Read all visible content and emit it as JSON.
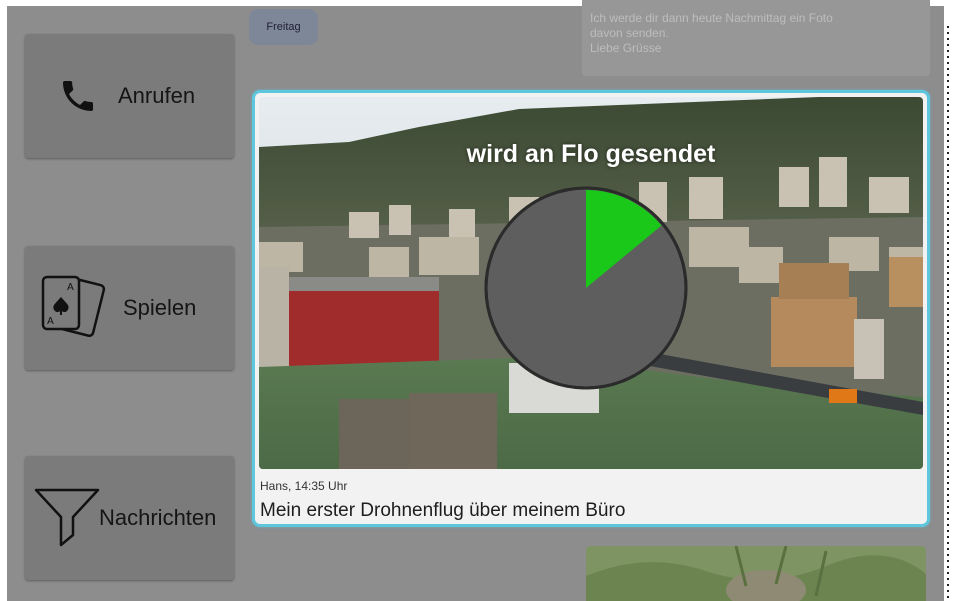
{
  "sidebar": {
    "call_label": "Anrufen",
    "play_label": "Spielen",
    "messages_label": "Nachrichten"
  },
  "chat": {
    "day_label": "Freitag",
    "previous_message_lines": [
      "",
      "Ich werde dir dann heute Nachmittag ein Foto",
      "davon senden.",
      "Liebe Grüsse"
    ],
    "selected_message": {
      "sending_status": "wird an Flo gesendet",
      "send_progress": 0.14,
      "author_time": "Hans, 14:35 Uhr",
      "caption": "Mein erster Drohnenflug über meinem Büro"
    }
  },
  "colors": {
    "selection_border": "#5ec6dd",
    "progress_fill": "#19c819",
    "progress_track": "#5e5e5e"
  }
}
